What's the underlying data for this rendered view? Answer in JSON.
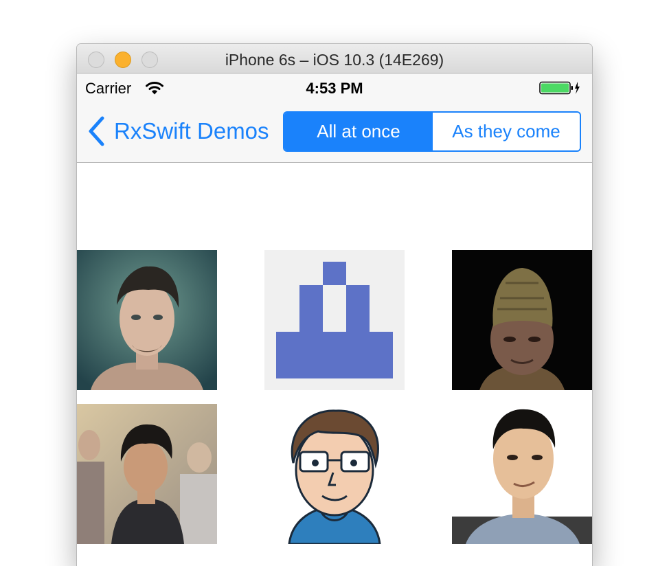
{
  "window": {
    "title": "iPhone 6s – iOS 10.3 (14E269)",
    "buttons": [
      "close-button",
      "minimize-button",
      "zoom-button"
    ]
  },
  "status_bar": {
    "carrier": "Carrier",
    "time": "4:53 PM",
    "battery_color": "#4cd964"
  },
  "nav_bar": {
    "back_label": "RxSwift Demos",
    "segments": [
      "All at once",
      "As they come"
    ],
    "selected_segment": 0,
    "tint_color": "#1a82fb"
  },
  "grid": {
    "columns": 3,
    "images": [
      "photo-avatar",
      "identicon-avatar",
      "helmet-soldier-avatar",
      "photo-avatar",
      "cartoon-avatar",
      "photo-avatar"
    ]
  }
}
